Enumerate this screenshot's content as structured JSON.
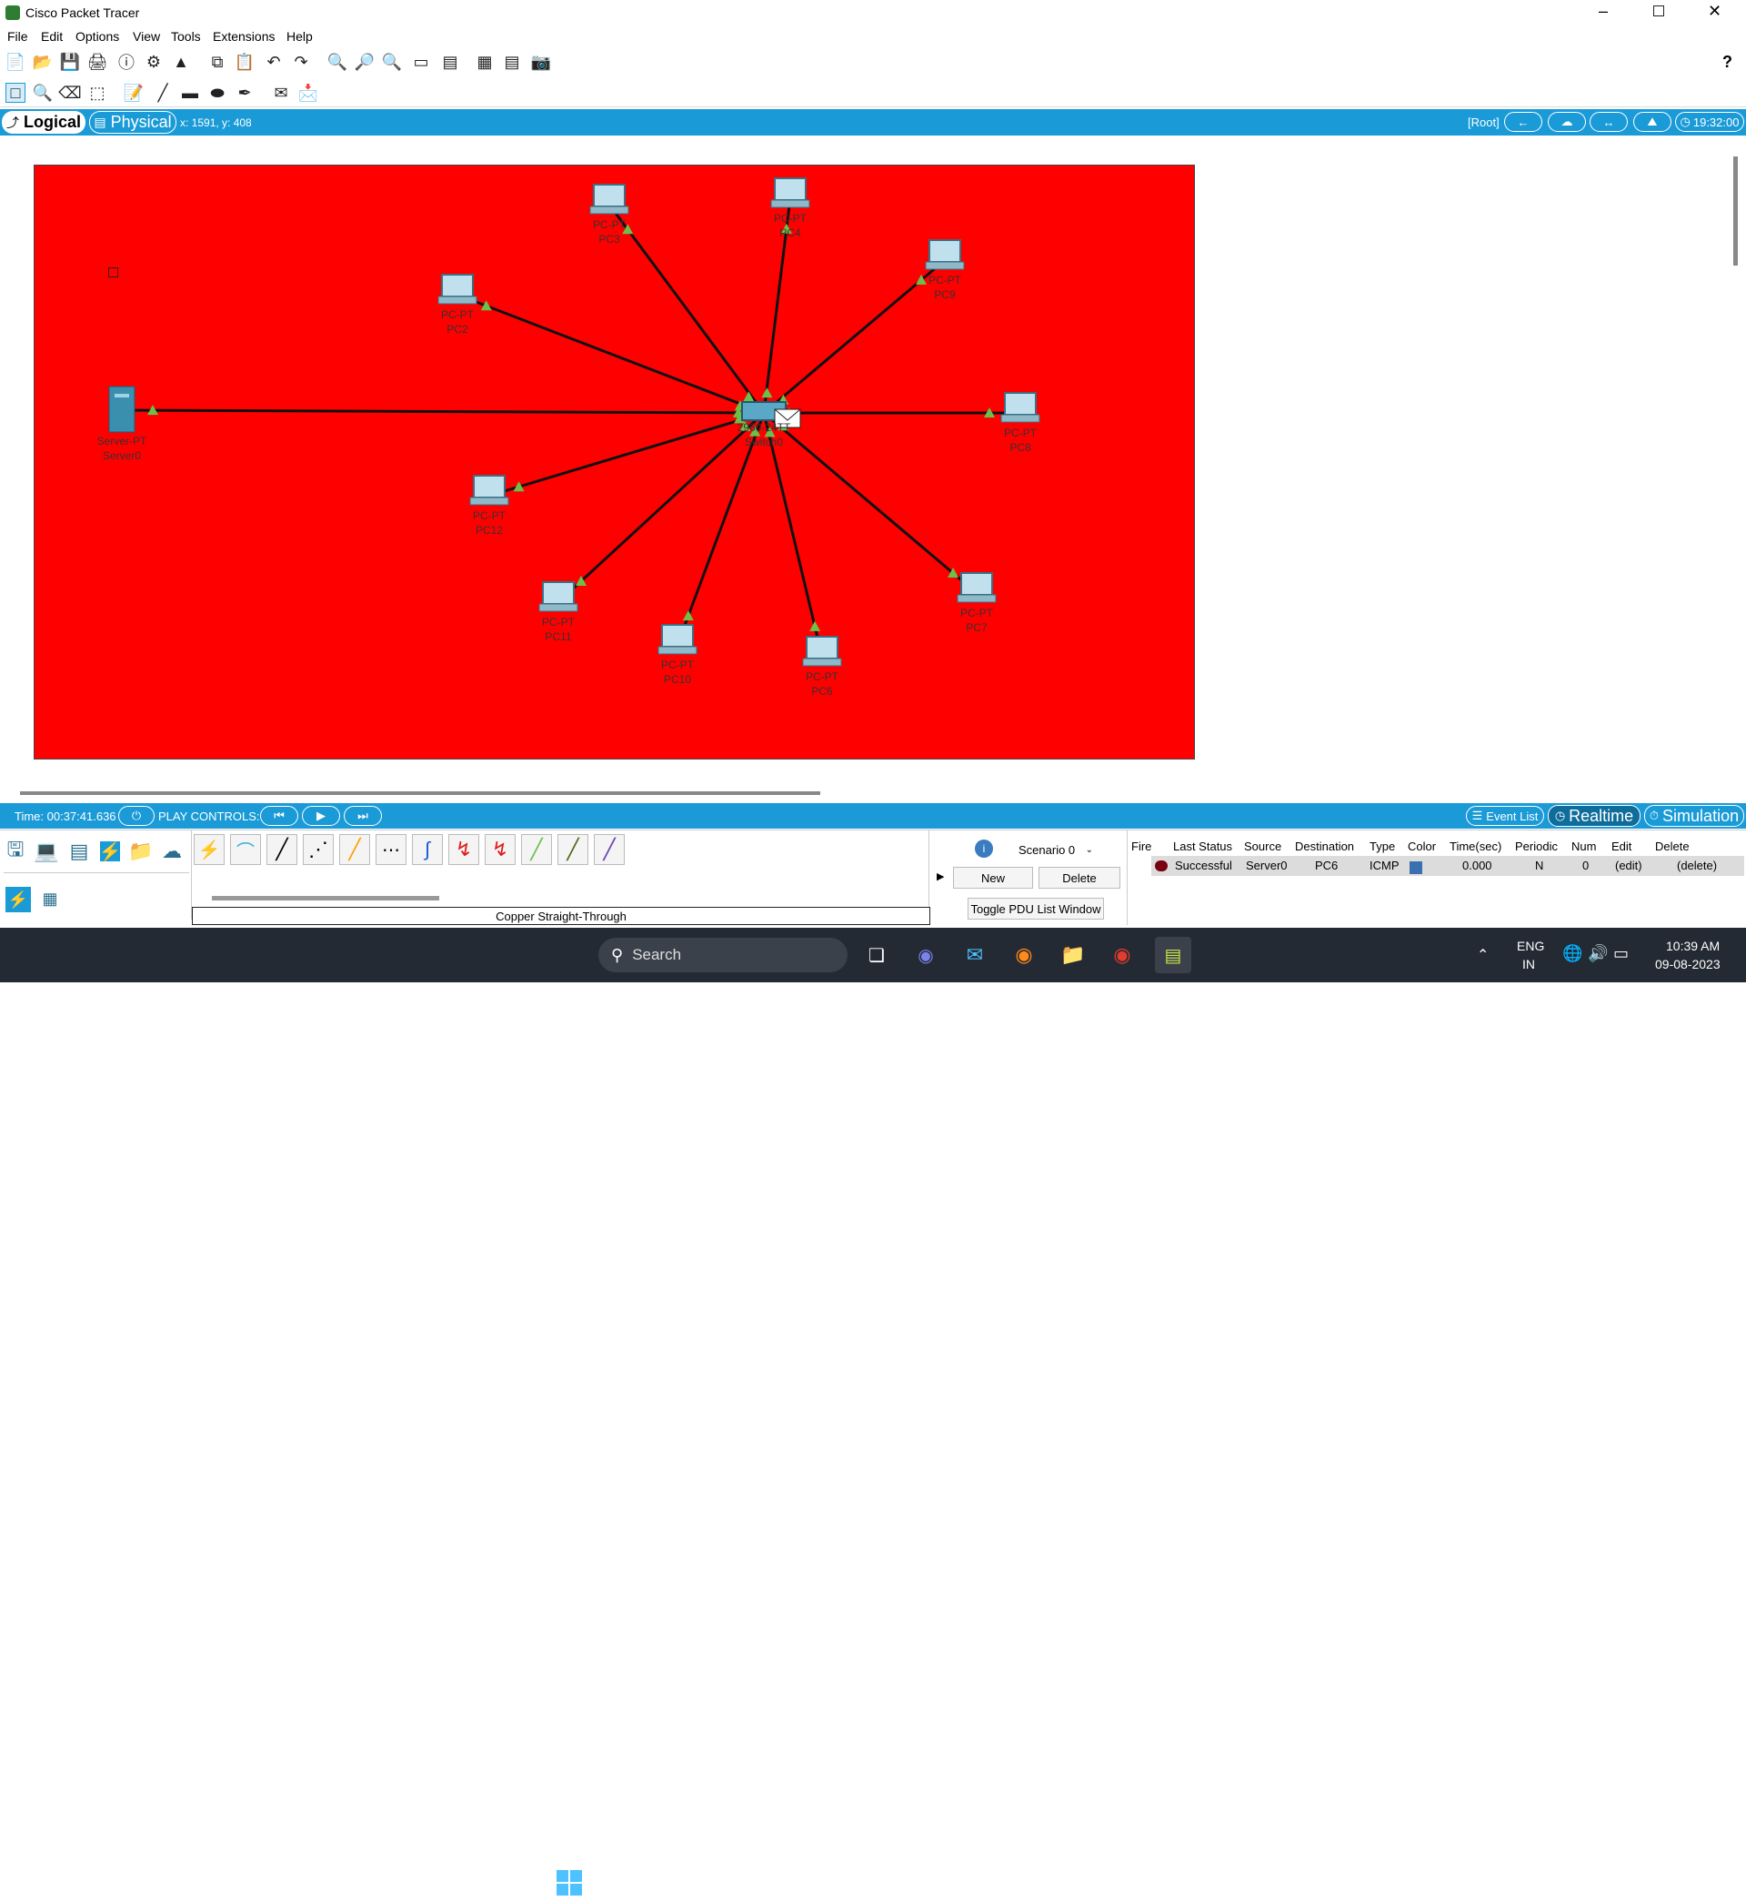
{
  "window": {
    "title": "Cisco Packet Tracer",
    "help_glyph": "?"
  },
  "menu": [
    "File",
    "Edit",
    "Options",
    "View",
    "Tools",
    "Extensions",
    "Help"
  ],
  "workspace_bar": {
    "logical_label": "Logical",
    "physical_label": "Physical",
    "coords": "x: 1591, y: 408",
    "root_label": "[Root]",
    "clock": "19:32:00"
  },
  "network": {
    "background_color": "#ff0000",
    "link_color": "#111111",
    "link_light_color": "#6cc04a",
    "switch": {
      "type": "2960-24TT",
      "name": "Switch0"
    },
    "devices": [
      {
        "type": "PC-PT",
        "name": "PC3"
      },
      {
        "type": "PC-PT",
        "name": "PC4"
      },
      {
        "type": "PC-PT",
        "name": "PC9"
      },
      {
        "type": "PC-PT",
        "name": "PC2"
      },
      {
        "type": "Server-PT",
        "name": "Server0"
      },
      {
        "type": "PC-PT",
        "name": "PC8"
      },
      {
        "type": "PC-PT",
        "name": "PC12"
      },
      {
        "type": "PC-PT",
        "name": "PC11"
      },
      {
        "type": "PC-PT",
        "name": "PC10"
      },
      {
        "type": "PC-PT",
        "name": "PC6"
      },
      {
        "type": "PC-PT",
        "name": "PC7"
      }
    ]
  },
  "sim_bar": {
    "time": "Time: 00:37:41.636",
    "play_controls": "PLAY CONTROLS:",
    "event_list": "Event List",
    "realtime": "Realtime",
    "simulation": "Simulation"
  },
  "device_panel": {
    "selected_connection": "Copper Straight-Through"
  },
  "scenario": {
    "selected": "Scenario 0",
    "new_label": "New",
    "delete_label": "Delete",
    "toggle_label": "Toggle PDU List Window"
  },
  "pdu_table": {
    "headers": [
      "Fire",
      "Last Status",
      "Source",
      "Destination",
      "Type",
      "Color",
      "Time(sec)",
      "Periodic",
      "Num",
      "Edit",
      "Delete"
    ],
    "rows": [
      {
        "last_status": "Successful",
        "source": "Server0",
        "destination": "PC6",
        "type": "ICMP",
        "color": "#3a6fb0",
        "time": "0.000",
        "periodic": "N",
        "num": "0",
        "edit": "(edit)",
        "delete": "(delete)"
      }
    ]
  },
  "taskbar": {
    "search_placeholder": "Search",
    "lang1": "ENG",
    "lang2": "IN",
    "time": "10:39 AM",
    "date": "09-08-2023"
  }
}
